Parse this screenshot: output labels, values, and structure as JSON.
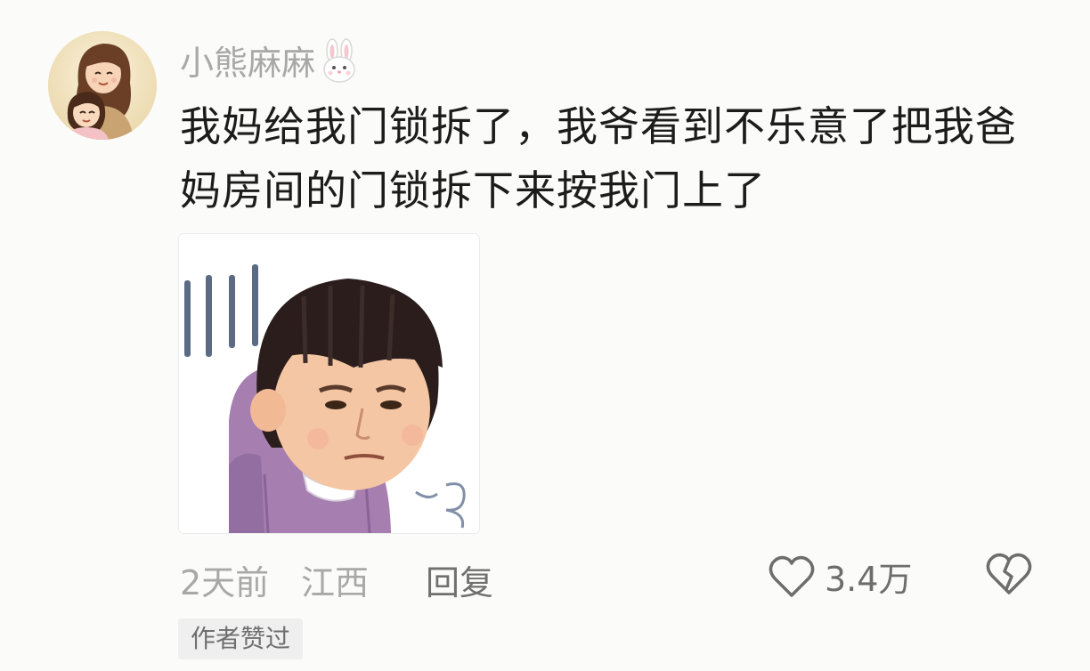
{
  "comment": {
    "username": "小熊麻麻",
    "text": "我妈给我门锁拆了，我爷看到不乐意了把我爸妈房间的门锁拆下来按我门上了",
    "time": "2天前",
    "location": "江西",
    "reply_label": "回复",
    "like_count": "3.4万",
    "author_badge": "作者赞过",
    "username_icon": "rabbit-icon",
    "like_icon": "heart-icon",
    "dislike_icon": "broken-heart-icon"
  },
  "colors": {
    "muted": "#a8a8a8",
    "text": "#1c1c1c",
    "badge_bg": "#efefef"
  }
}
